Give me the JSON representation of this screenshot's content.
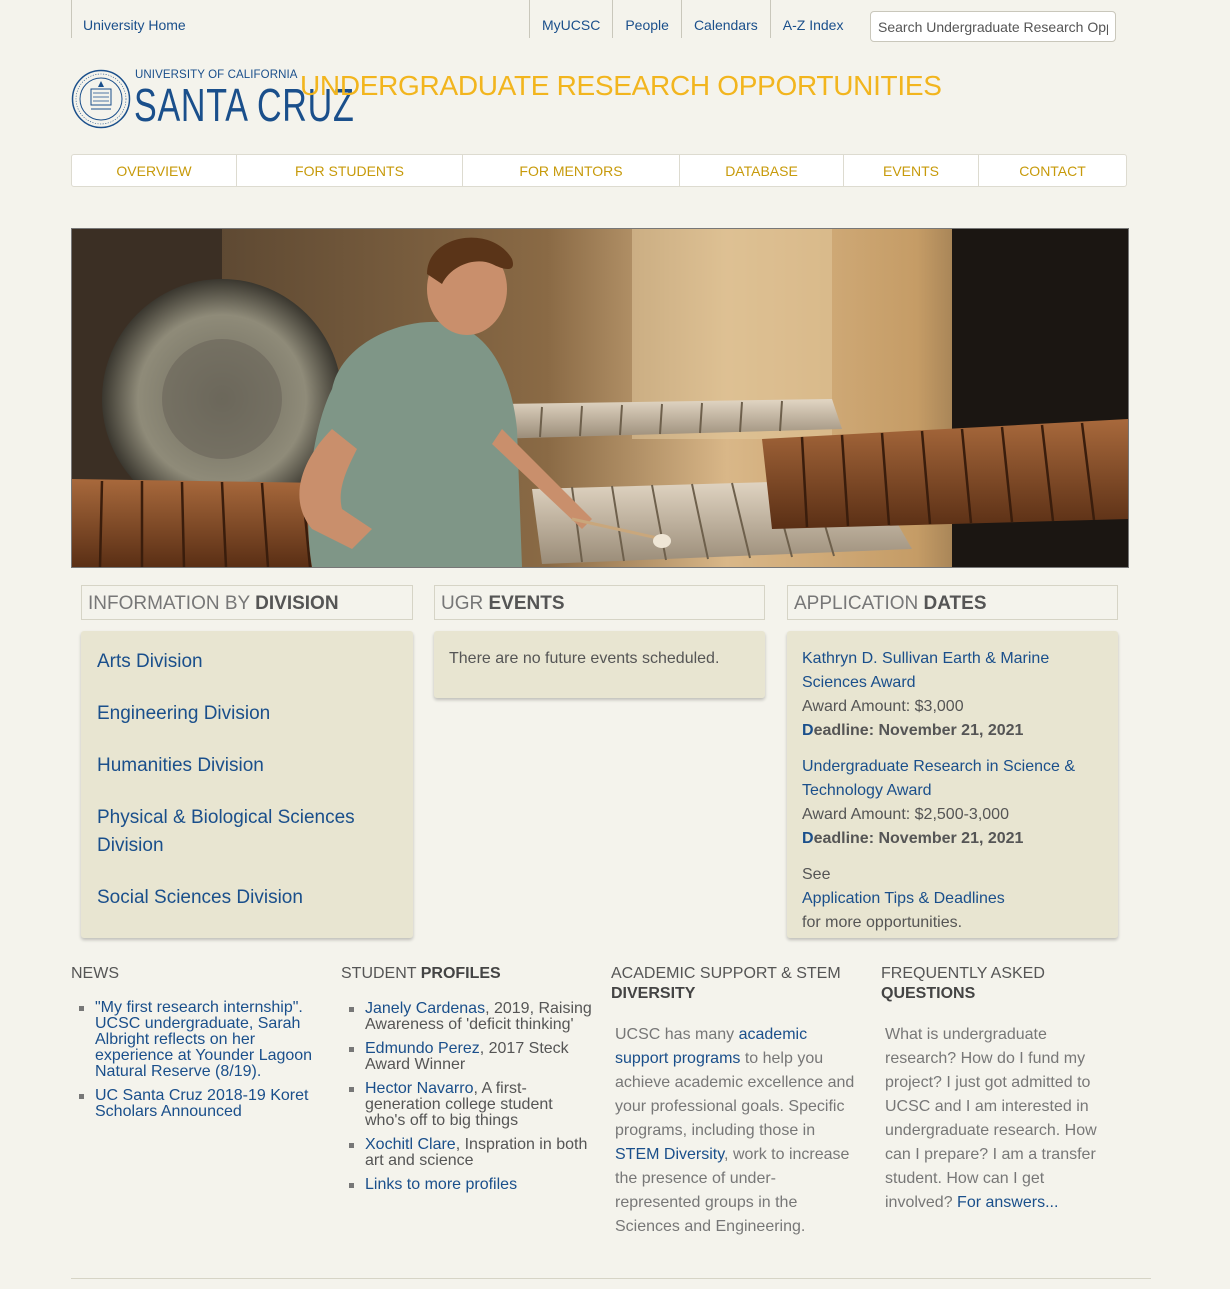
{
  "topbar": {
    "home": "University Home",
    "links": [
      "MyUCSC",
      "People",
      "Calendars",
      "A-Z Index"
    ],
    "search_placeholder": "Search Undergraduate Research Opportunities"
  },
  "logo": {
    "line1": "UNIVERSITY OF CALIFORNIA",
    "line2": "SANTA CRUZ"
  },
  "site_title": "UNDERGRADUATE RESEARCH OPPORTUNITIES",
  "nav": [
    "OVERVIEW",
    "FOR STUDENTS",
    "FOR MENTORS",
    "DATABASE",
    "EVENTS",
    "CONTACT"
  ],
  "division": {
    "heading_plain": "INFORMATION BY ",
    "heading_bold": "DIVISION",
    "items": [
      "Arts Division",
      "Engineering Division",
      "Humanities Division",
      "Physical & Biological Sciences Division",
      "Social Sciences Division"
    ]
  },
  "events": {
    "heading_plain": "UGR ",
    "heading_bold": "EVENTS",
    "empty_text": "There are no future events scheduled."
  },
  "dates": {
    "heading_plain": "APPLICATION ",
    "heading_bold": "DATES",
    "items": [
      {
        "title": "Kathryn D. Sullivan Earth & Marine Sciences Award",
        "amount": "Award Amount: $3,000",
        "deadline_first": "D",
        "deadline_rest": "eadline: November 21, 2021"
      },
      {
        "title": "Undergraduate Research in Science & Technology Award",
        "amount": "Award Amount: $2,500-3,000",
        "deadline_first": "D",
        "deadline_rest": "eadline: November 21, 2021"
      }
    ],
    "more_prefix": "See ",
    "more_link": "Application Tips & Deadlines",
    "more_suffix": " for more opportunities."
  },
  "news": {
    "heading": "NEWS",
    "items": [
      "\"My first research internship\". UCSC undergraduate, Sarah Albright reflects on her experience at Younder Lagoon Natural Reserve (8/19).",
      "UC Santa Cruz 2018-19 Koret Scholars Announced"
    ]
  },
  "profiles": {
    "heading_plain": "STUDENT ",
    "heading_bold": "PROFILES",
    "items": [
      {
        "link": "Janely Cardenas",
        "text": ", 2019, Raising Awareness of 'deficit thinking'"
      },
      {
        "link": "Edmundo Perez",
        "text": ", 2017 Steck Award Winner"
      },
      {
        "link": "Hector Navarro",
        "text": ", A first-generation college student who's off to big things"
      },
      {
        "link": "Xochitl Clare",
        "text": ", Inspration in both art and science"
      },
      {
        "link": "Links to more profiles",
        "text": ""
      }
    ]
  },
  "academic": {
    "heading_plain": "ACADEMIC SUPPORT & STEM ",
    "heading_bold": "DIVERSITY",
    "t1": "UCSC has many ",
    "l1": "academic support programs",
    "t2": " to help you achieve academic excellence and your professional goals. Specific programs, including those in ",
    "l2": "STEM Diversity",
    "t3": ", work to increase the presence of under-represented groups in the Sciences and Engineering."
  },
  "faq": {
    "heading_plain": "FREQUENTLY ASKED ",
    "heading_bold": "QUESTIONS",
    "text": "What is undergraduate research? How do I fund my project? I just got admitted to UCSC and I am interested in undergraduate research.  How can I prepare? I am a transfer student. How can I get involved? ",
    "link": "For answers..."
  },
  "colors": {
    "background": "#f4f3ec",
    "link": "#1a4f8b",
    "title_gold": "#f2b51e",
    "nav_gold": "#c79a0a",
    "panel": "#e8e5d1"
  }
}
